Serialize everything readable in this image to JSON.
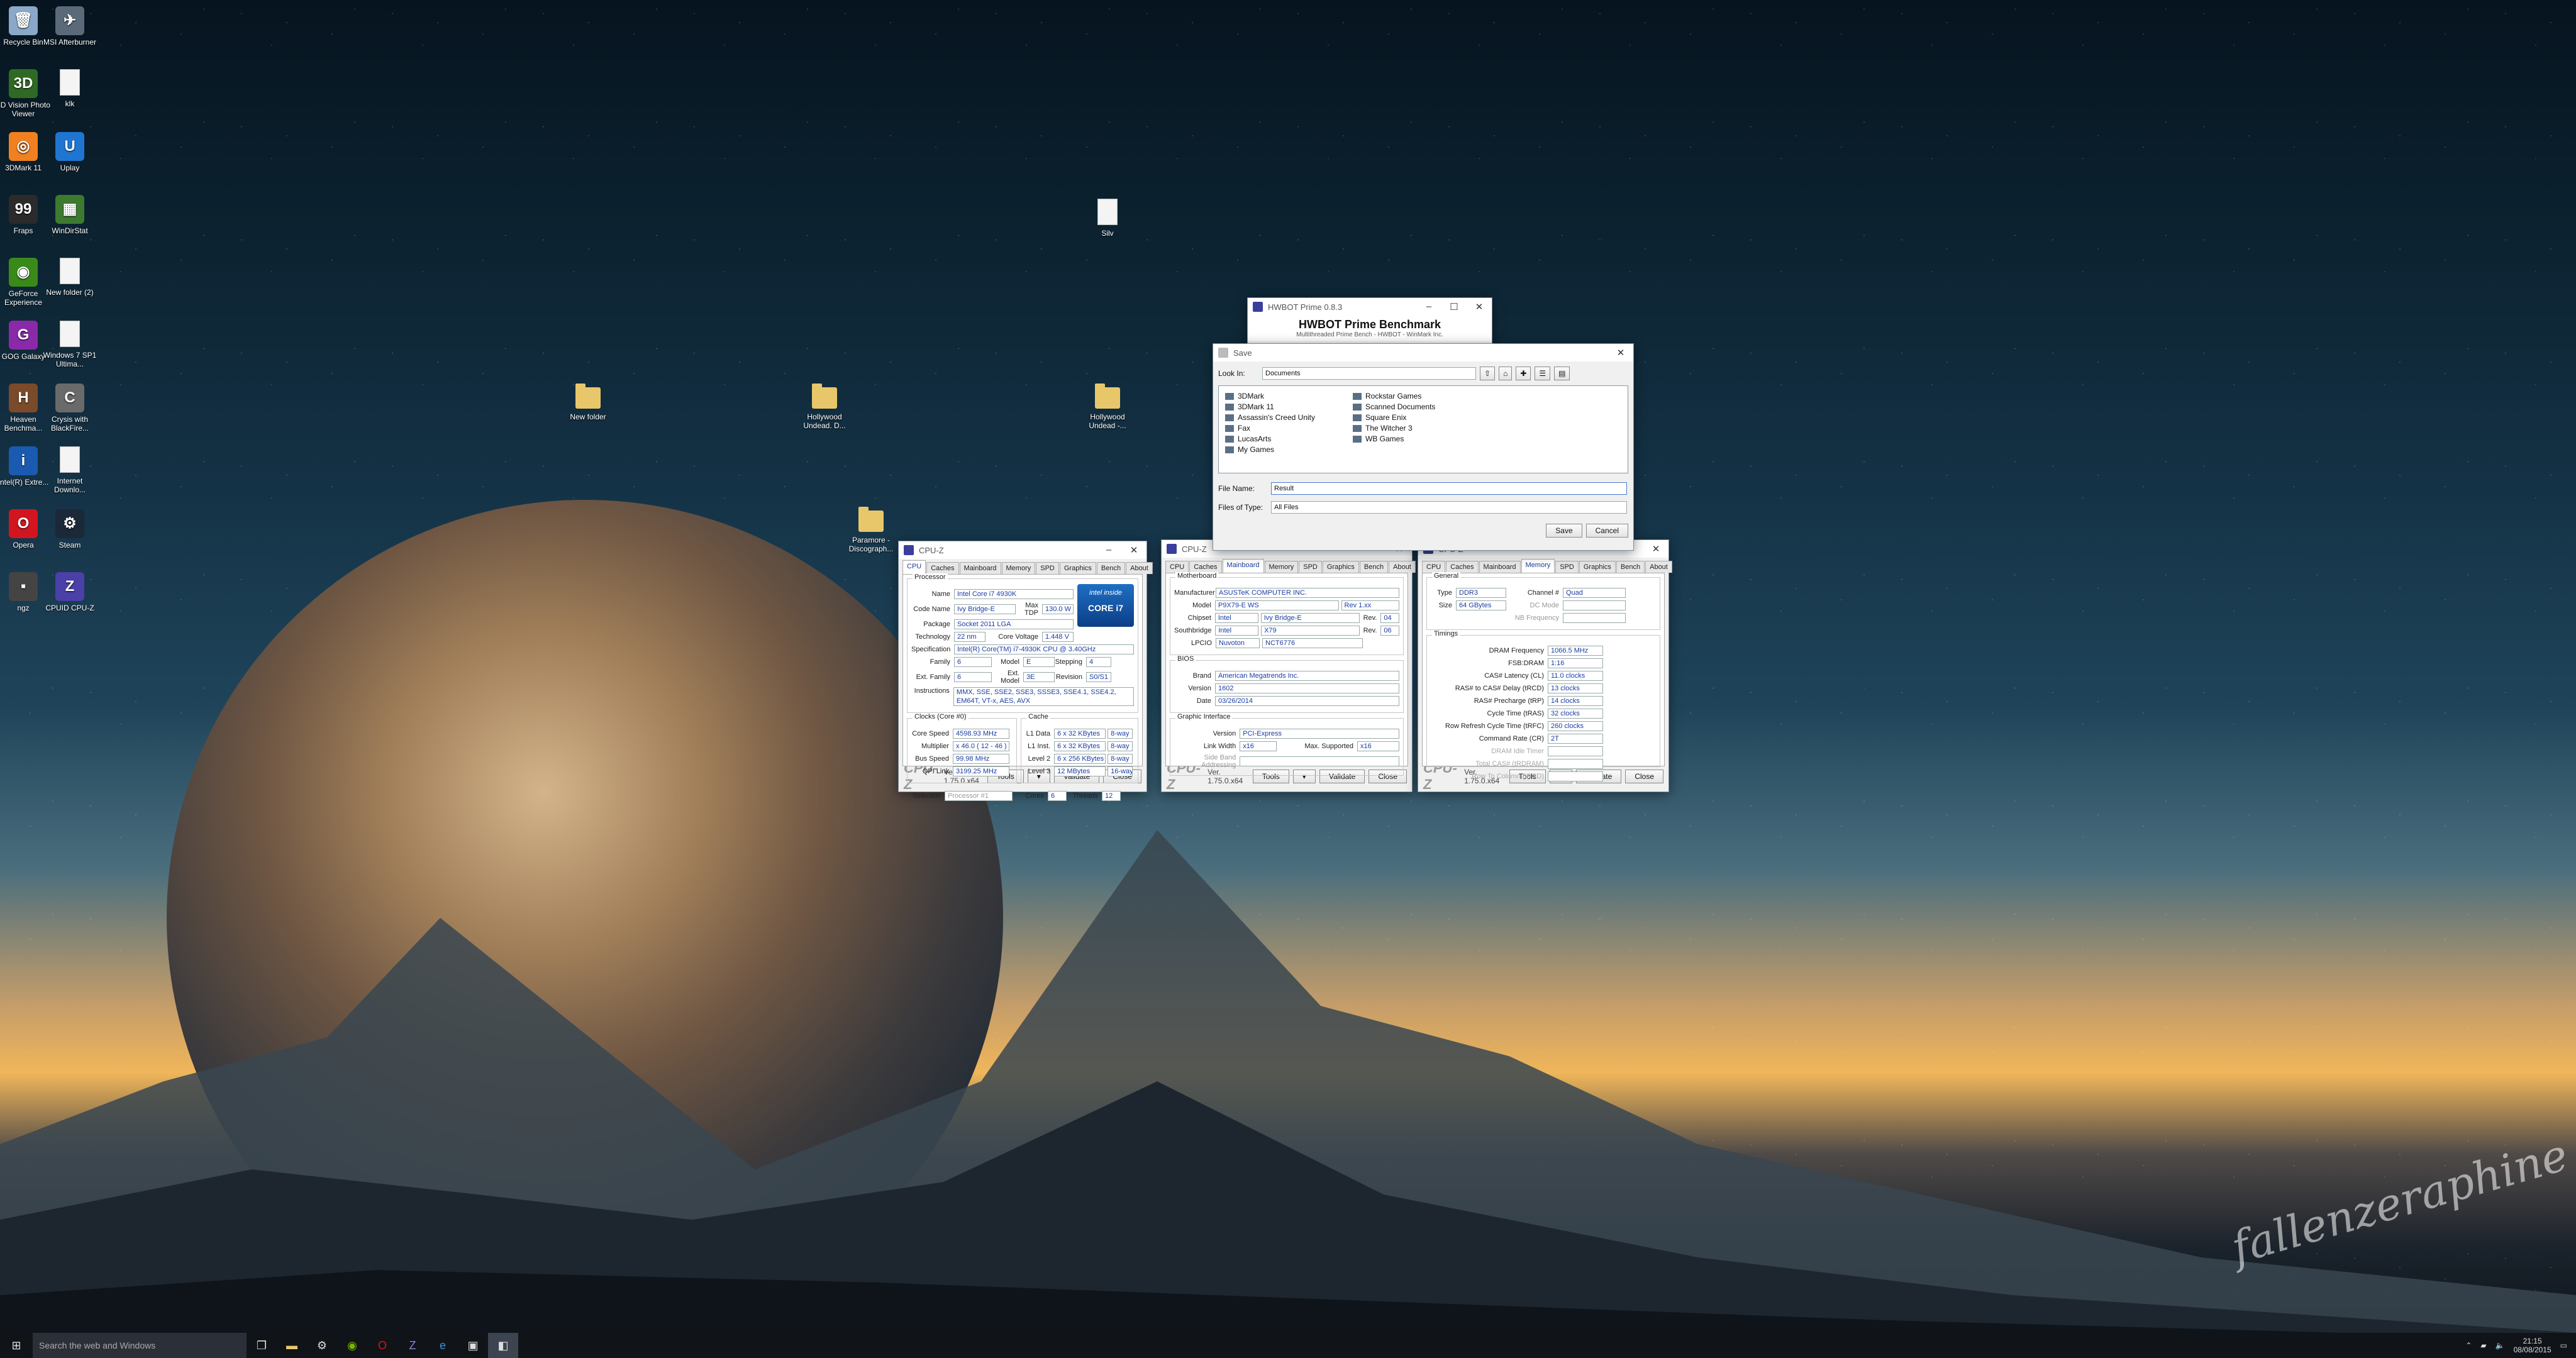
{
  "desktop": {
    "icons_left": [
      {
        "label": "Recycle Bin",
        "icon": "recycle-bin-icon",
        "glyph": "🗑",
        "color": "#8aa8c8"
      },
      {
        "label": "MSI Afterburner",
        "icon": "msi-afterburner-icon",
        "glyph": "✈",
        "color": "#5a6a78"
      },
      {
        "label": "3D Vision Photo Viewer",
        "icon": "3d-vision-icon",
        "glyph": "3D",
        "color": "#2f6a24"
      },
      {
        "label": "klk",
        "icon": "file-icon",
        "glyph": "",
        "color": "#f4f4f4"
      },
      {
        "label": "3DMark 11",
        "icon": "3dmark-icon",
        "glyph": "◎",
        "color": "#f08020"
      },
      {
        "label": "Uplay",
        "icon": "uplay-icon",
        "glyph": "U",
        "color": "#1f76d2"
      },
      {
        "label": "Fraps",
        "icon": "fraps-icon",
        "glyph": "99",
        "color": "#2b2b2b"
      },
      {
        "label": "WinDirStat",
        "icon": "windirstat-icon",
        "glyph": "▦",
        "color": "#3d7a2f"
      },
      {
        "label": "GeForce Experience",
        "icon": "geforce-icon",
        "glyph": "◉",
        "color": "#3a8a1a"
      },
      {
        "label": "New folder (2)",
        "icon": "file-icon",
        "glyph": "",
        "color": "#f4f4f4"
      },
      {
        "label": "GOG Galaxy",
        "icon": "gog-galaxy-icon",
        "glyph": "G",
        "color": "#8a2aa8"
      },
      {
        "label": "Windows 7 SP1 Ultima...",
        "icon": "file-icon",
        "glyph": "",
        "color": "#f4f4f4"
      },
      {
        "label": "Heaven Benchma...",
        "icon": "heaven-icon",
        "glyph": "H",
        "color": "#7a4a2a"
      },
      {
        "label": "Crysis with BlackFire...",
        "icon": "crysis-icon",
        "glyph": "C",
        "color": "#6a6a6a"
      },
      {
        "label": "Intel(R) Extre...",
        "icon": "intel-xtu-icon",
        "glyph": "i",
        "color": "#1a5ab0"
      },
      {
        "label": "Internet Downlo...",
        "icon": "file-icon",
        "glyph": "",
        "color": "#f4f4f4"
      },
      {
        "label": "Opera",
        "icon": "opera-icon",
        "glyph": "O",
        "color": "#d3151f"
      },
      {
        "label": "Steam",
        "icon": "steam-icon",
        "glyph": "⚙",
        "color": "#1b2838"
      },
      {
        "label": "ngz",
        "icon": "ngz-icon",
        "glyph": "▪",
        "color": "#444"
      },
      {
        "label": "CPUID CPU-Z",
        "icon": "cpuz-icon",
        "glyph": "Z",
        "color": "#4b3fa8"
      }
    ],
    "folders": [
      {
        "label": "Silv",
        "kind": "doc"
      },
      {
        "label": "New folder",
        "kind": "folder"
      },
      {
        "label": "Hollywood Undead. D...",
        "kind": "folder"
      },
      {
        "label": "Hollywood Undead -...",
        "kind": "folder"
      },
      {
        "label": "Paramore - Discograph...",
        "kind": "folder"
      }
    ],
    "signature": "fallenzeraphine"
  },
  "hwbot": {
    "title": "HWBOT Prime 0.8.3",
    "heading": "HWBOT Prime Benchmark",
    "subheading": "Multithreaded Prime Bench - HWBOT - WinMark Inc."
  },
  "save_dialog": {
    "title": "Save",
    "look_in_label": "Look In:",
    "look_in_value": "Documents",
    "files_col1": [
      "3DMark",
      "3DMark 11",
      "Assassin's Creed Unity",
      "Fax",
      "LucasArts",
      "My Games"
    ],
    "files_col2": [
      "Rockstar Games",
      "Scanned Documents",
      "Square Enix",
      "The Witcher 3",
      "WB Games"
    ],
    "file_name_label": "File Name:",
    "file_name_value": "Result",
    "files_type_label": "Files of Type:",
    "files_type_value": "All Files",
    "save_label": "Save",
    "cancel_label": "Cancel"
  },
  "cpuz_common": {
    "title": "CPU-Z",
    "tabs": [
      "CPU",
      "Caches",
      "Mainboard",
      "Memory",
      "SPD",
      "Graphics",
      "Bench",
      "About"
    ],
    "brand": "CPU-Z",
    "version": "Ver. 1.75.0.x64",
    "tools": "Tools",
    "validate": "Validate",
    "close": "Close"
  },
  "cpu": {
    "processor_title": "Processor",
    "name_l": "Name",
    "name": "Intel Core i7 4930K",
    "code_l": "Code Name",
    "code": "Ivy Bridge-E",
    "tdp_l": "Max TDP",
    "tdp": "130.0 W",
    "package_l": "Package",
    "package": "Socket 2011 LGA",
    "tech_l": "Technology",
    "tech": "22 nm",
    "cv_l": "Core Voltage",
    "cv": "1.448 V",
    "spec_l": "Specification",
    "spec": "Intel(R) Core(TM) i7-4930K CPU @ 3.40GHz",
    "family_l": "Family",
    "family": "6",
    "model_l": "Model",
    "model": "E",
    "stepping_l": "Stepping",
    "stepping": "4",
    "extfam_l": "Ext. Family",
    "extfam": "6",
    "extmod_l": "Ext. Model",
    "extmod": "3E",
    "rev_l": "Revision",
    "rev": "S0/S1",
    "instr_l": "Instructions",
    "instr": "MMX, SSE, SSE2, SSE3, SSSE3, SSE4.1, SSE4.2, EM64T, VT-x, AES, AVX",
    "clocks_title": "Clocks (Core #0)",
    "cspeed_l": "Core Speed",
    "cspeed": "4598.93 MHz",
    "mult_l": "Multiplier",
    "mult": "x 46.0 ( 12 - 46 )",
    "bus_l": "Bus Speed",
    "bus": "99.98 MHz",
    "qpi_l": "QPI Link",
    "qpi": "3199.25 MHz",
    "cache_title": "Cache",
    "l1d_l": "L1 Data",
    "l1d": "6 x 32 KBytes",
    "l1d_w": "8-way",
    "l1i_l": "L1 Inst.",
    "l1i": "6 x 32 KBytes",
    "l1i_w": "8-way",
    "l2_l": "Level 2",
    "l2": "6 x 256 KBytes",
    "l2_w": "8-way",
    "l3_l": "Level 3",
    "l3": "12 MBytes",
    "l3_w": "16-way",
    "sel_l": "Selection",
    "sel": "Processor #1",
    "cores_l": "Cores",
    "cores": "6",
    "threads_l": "Threads",
    "threads": "12",
    "logo_top": "intel inside",
    "logo_bot": "CORE i7"
  },
  "mainboard": {
    "mb_title": "Motherboard",
    "manu_l": "Manufacturer",
    "manu": "ASUSTeK COMPUTER INC.",
    "model_l": "Model",
    "model": "P9X79-E WS",
    "rev": "Rev 1.xx",
    "chipset_l": "Chipset",
    "chipset_a": "Intel",
    "chipset_b": "Ivy Bridge-E",
    "chip_rev_l": "Rev.",
    "chip_rev": "04",
    "south_l": "Southbridge",
    "south_a": "Intel",
    "south_b": "X79",
    "south_rev_l": "Rev.",
    "south_rev": "06",
    "lpcio_l": "LPCIO",
    "lpcio_a": "Nuvoton",
    "lpcio_b": "NCT6776",
    "bios_title": "BIOS",
    "brand_l": "Brand",
    "brand": "American Megatrends Inc.",
    "version_l": "Version",
    "version": "1602",
    "date_l": "Date",
    "date": "03/26/2014",
    "gi_title": "Graphic Interface",
    "giv_l": "Version",
    "giv": "PCI-Express",
    "lw_l": "Link Width",
    "lw": "x16",
    "ms_l": "Max. Supported",
    "ms": "x16",
    "sba_l": "Side Band Addressing"
  },
  "memory": {
    "gen_title": "General",
    "type_l": "Type",
    "type": "DDR3",
    "chan_l": "Channel #",
    "chan": "Quad",
    "size_l": "Size",
    "size": "64 GBytes",
    "dc_l": "DC Mode",
    "nb_l": "NB Frequency",
    "tim_title": "Timings",
    "rows": [
      {
        "l": "DRAM Frequency",
        "v": "1066.5 MHz"
      },
      {
        "l": "FSB:DRAM",
        "v": "1:16"
      },
      {
        "l": "CAS# Latency (CL)",
        "v": "11.0 clocks"
      },
      {
        "l": "RAS# to CAS# Delay (tRCD)",
        "v": "13 clocks"
      },
      {
        "l": "RAS# Precharge (tRP)",
        "v": "14 clocks"
      },
      {
        "l": "Cycle Time (tRAS)",
        "v": "32 clocks"
      },
      {
        "l": "Row Refresh Cycle Time (tRFC)",
        "v": "260 clocks"
      },
      {
        "l": "Command Rate (CR)",
        "v": "2T"
      }
    ],
    "dim_rows": [
      "DRAM Idle Timer",
      "Total CAS# (tRDRAM)",
      "Row To Column (tRCD)"
    ]
  },
  "taskbar": {
    "search_placeholder": "Search the web and Windows",
    "time": "21:15",
    "date": "08/08/2015"
  }
}
